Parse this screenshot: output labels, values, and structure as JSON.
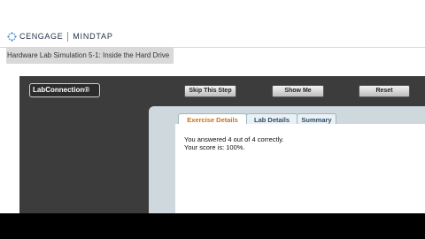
{
  "header": {
    "brand": "CENGAGE",
    "product": "MINDTAP"
  },
  "page": {
    "title": "Hardware Lab Simulation 5-1: Inside the Hard Drive"
  },
  "simulation": {
    "logo": "LabConnection®",
    "buttons": {
      "skip": "Skip This Step",
      "show": "Show Me",
      "reset": "Reset"
    },
    "tabs": [
      "Exercise Details",
      "Lab Details",
      "Summary"
    ],
    "active_tab": "Exercise Details",
    "messages": [
      "You answered 4 out of 4 correctly.",
      "Your score is: 100%."
    ]
  },
  "colors": {
    "accent_tab_text": "#c5731b",
    "sim_background": "#3c3c3c"
  }
}
